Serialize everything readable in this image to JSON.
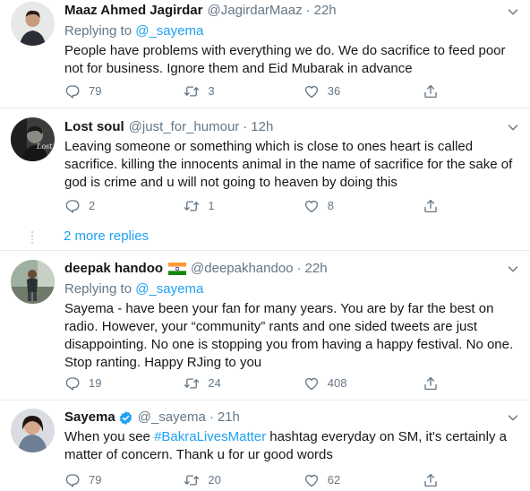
{
  "tweets": [
    {
      "name": "Maaz Ahmed Jagirdar",
      "handle": "@JagirdarMaaz",
      "sep": "·",
      "time": "22h",
      "replying_prefix": "Replying to ",
      "replying_handle": "@_sayema",
      "body": "People have problems with everything we do. We do sacrifice to feed poor not for business.  Ignore them and Eid Mubarak in advance",
      "replies": "79",
      "retweets": "3",
      "likes": "36"
    },
    {
      "name": "Lost soul",
      "handle": "@just_for_humour",
      "sep": "·",
      "time": "12h",
      "avatar_text": "Lost",
      "body": "Leaving someone or something which is close to ones heart is called sacrifice. killing the innocents animal in the name of sacrifice for the sake of god is crime and u will not going to heaven by doing this",
      "replies": "2",
      "retweets": "1",
      "likes": "8"
    },
    {
      "name": "deepak handoo",
      "handle": "@deepakhandoo",
      "sep": "·",
      "time": "22h",
      "replying_prefix": "Replying to ",
      "replying_handle": "@_sayema",
      "body": "Sayema - have been your fan for many years. You are by far the best on radio. However, your “community” rants and one sided tweets are just disappointing. No one is stopping you from having a happy festival. No one. Stop ranting. Happy RJing to you",
      "replies": "19",
      "retweets": "24",
      "likes": "408"
    },
    {
      "name": "Sayema",
      "handle": "@_sayema",
      "sep": "·",
      "time": "21h",
      "body_before": "When you see ",
      "body_hashtag": "#BakraLivesMatter",
      "body_after": " hashtag everyday on SM, it's certainly a matter of concern. Thank u for ur good words",
      "replies": "79",
      "retweets": "20",
      "likes": "62"
    }
  ],
  "more_replies": "2 more replies",
  "colors": {
    "link": "#1da1f2",
    "secondary": "#657786",
    "text": "#14171a",
    "divider": "#e6ecf0",
    "verified": "#1da1f2"
  },
  "icons": [
    "reply-icon",
    "retweet-icon",
    "like-icon",
    "share-icon",
    "more-icon",
    "verified-icon",
    "india-flag-icon"
  ]
}
